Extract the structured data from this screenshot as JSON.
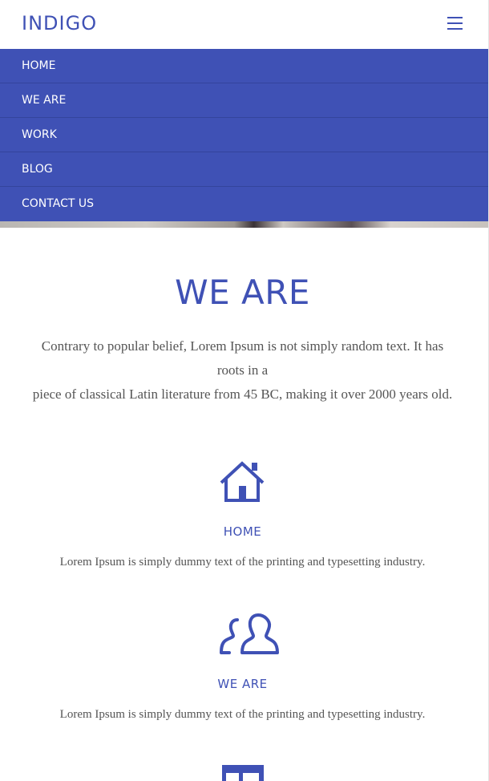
{
  "header": {
    "brand": "INDIGO",
    "menu_icon": "hamburger-icon"
  },
  "menu": {
    "items": [
      {
        "label": "HOME"
      },
      {
        "label": "WE ARE"
      },
      {
        "label": "WORK"
      },
      {
        "label": "BLOG"
      },
      {
        "label": "CONTACT US"
      }
    ]
  },
  "about": {
    "title": "WE ARE",
    "line1": "Contrary to popular belief, Lorem Ipsum is not simply random text. It has",
    "line2": "roots in a",
    "line3": "piece of classical Latin literature from 45 BC, making it over 2000 years old."
  },
  "features": [
    {
      "icon": "home-icon",
      "title": "HOME",
      "text": "Lorem Ipsum is simply dummy text of the printing and typesetting industry."
    },
    {
      "icon": "users-icon",
      "title": "WE ARE",
      "text": "Lorem Ipsum is simply dummy text of the printing and typesetting industry."
    },
    {
      "icon": "layout-icon"
    }
  ],
  "colors": {
    "accent": "#3f51b5",
    "text": "#555555",
    "background": "#ffffff"
  }
}
